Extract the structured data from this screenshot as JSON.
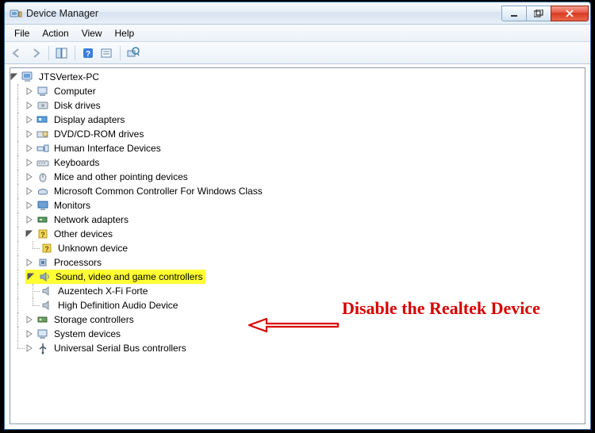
{
  "window": {
    "title": "Device Manager"
  },
  "menubar": {
    "file": "File",
    "action": "Action",
    "view": "View",
    "help": "Help"
  },
  "tree": {
    "root": "JTSVertex-PC",
    "computer": "Computer",
    "disk_drives": "Disk drives",
    "display_adapters": "Display adapters",
    "dvd_cdrom": "DVD/CD-ROM drives",
    "hid": "Human Interface Devices",
    "keyboards": "Keyboards",
    "mice": "Mice and other pointing devices",
    "ms_controller": "Microsoft Common Controller For Windows Class",
    "monitors": "Monitors",
    "network": "Network adapters",
    "other_devices": "Other devices",
    "unknown_device": "Unknown device",
    "processors": "Processors",
    "sound": "Sound, video and game controllers",
    "auzentech": "Auzentech X-Fi Forte",
    "hd_audio": "High Definition Audio Device",
    "storage": "Storage controllers",
    "system_devices": "System devices",
    "usb": "Universal Serial Bus controllers"
  },
  "annotation": {
    "text": "Disable the Realtek Device"
  }
}
